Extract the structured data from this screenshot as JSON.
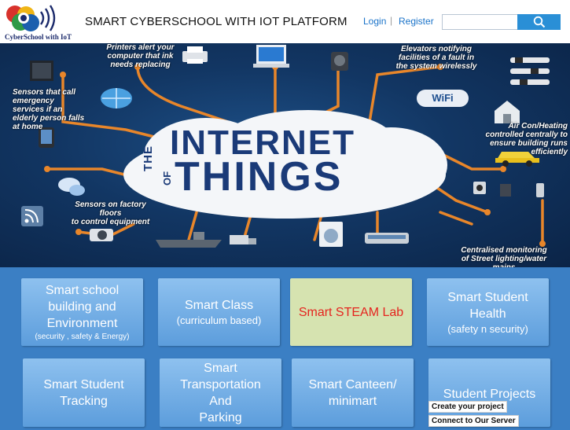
{
  "header": {
    "logo_text": "CyberSchool with IoT",
    "title": "SMART CYBERSCHOOL WITH IOT PLATFORM",
    "login_label": "Login",
    "separator": "|",
    "register_label": "Register",
    "search_placeholder": ""
  },
  "hero": {
    "logo_line_1": "THE",
    "logo_line_2": "INTERNET",
    "logo_line_3": "OF",
    "logo_line_4": "THINGS",
    "wifi_label": "WiFi",
    "captions": {
      "printers": "Printers alert your\ncomputer that ink\nneeds replacing",
      "elevators": "Elevators notifying\nfacilities of a fault in\nthe system wirelessly",
      "sensors_elderly": "Sensors that call\nemergency\nservices if an\nelderly person falls\nat home",
      "aircon": "Air Con/Heating\ncontrolled centrally to\nensure building runs\nefficiently",
      "factory": "Sensors on factory\nfloors\nto control equipment",
      "lighting": "Centralised monitoring\nof Street lighting/water\nmains"
    }
  },
  "tiles": [
    {
      "main": "Smart school\nbuilding and\nEnvironment",
      "sub": "(security , safety & Energy)"
    },
    {
      "main": "Smart Class",
      "sub": "(curriculum based)"
    },
    {
      "main": "Smart STEAM Lab",
      "sub": ""
    },
    {
      "main": "Smart Student\nHealth",
      "sub": "(safety n security)"
    },
    {
      "main": "Smart Student\nTracking",
      "sub": ""
    },
    {
      "main": "Smart\nTransportation\nAnd\nParking",
      "sub": ""
    },
    {
      "main": "Smart  Canteen/\nminimart",
      "sub": ""
    },
    {
      "main": "Student Projects",
      "sub": ""
    }
  ],
  "projects": {
    "create_label": "Create your project",
    "connect_label": "Connect to Our Server"
  },
  "colors": {
    "accent": "#2a8fd6",
    "tile_area": "#3b7fc4",
    "steam_tile": "#d6e3b0",
    "steam_text": "#e5241f",
    "hero_bg": "#123663",
    "wire": "#e8862a"
  }
}
